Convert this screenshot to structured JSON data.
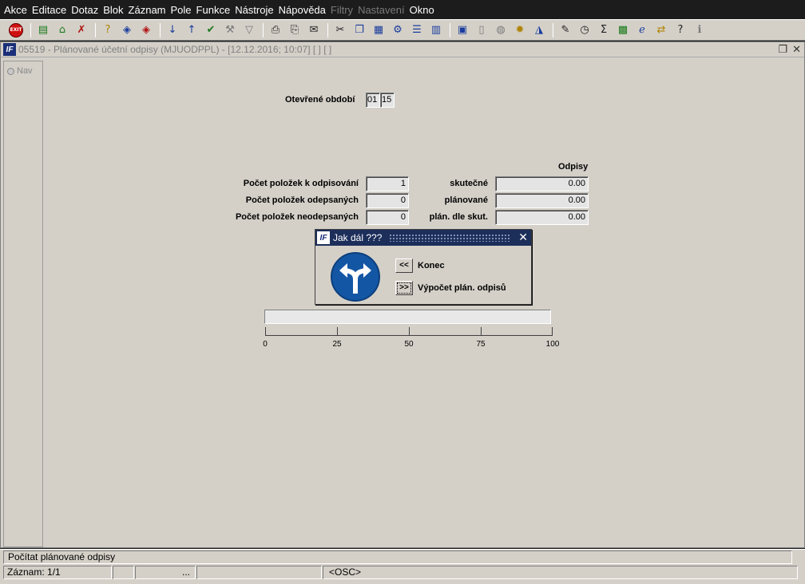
{
  "menu": [
    "Akce",
    "Editace",
    "Dotaz",
    "Blok",
    "Záznam",
    "Pole",
    "Funkce",
    "Nástroje",
    "Nápověda",
    "Filtry",
    "Nastavení",
    "Okno"
  ],
  "menu_disabled": [
    "Filtry",
    "Nastavení"
  ],
  "toolbar": {
    "exit_label": "EXIT",
    "icons": [
      "exit-icon",
      "insert-record-icon",
      "insert-record-alt-icon",
      "delete-record-icon",
      "query-icon",
      "query-run-icon",
      "query-cancel-icon",
      "sort-asc-icon",
      "sort-desc-icon",
      "check-icon",
      "wrench-icon",
      "filter-icon",
      "print-icon",
      "print-setup-icon",
      "mail-icon",
      "cut-icon",
      "copy-icon",
      "paste-icon",
      "tools-icon",
      "list-icon",
      "tree-icon",
      "report-icon",
      "document-icon",
      "globe-icon",
      "settings-icon",
      "eye-icon",
      "edit-icon",
      "calculator-icon",
      "sigma-icon",
      "excel-icon",
      "explorer-icon",
      "switch-icon",
      "help-icon",
      "info-icon"
    ]
  },
  "window": {
    "logo": "IF",
    "title": "05519 - Plánované účetní odpisy (MJUODPPL) - [12.12.2016; 10:07]  [ ]  [ ]",
    "nav_label": "Nav"
  },
  "form": {
    "period_label": "Otevřené období",
    "period_month": "01",
    "period_year": "15",
    "odpisy_header": "Odpisy",
    "rows": [
      {
        "label": "Počet položek k odpisování",
        "count": "1",
        "odpis_label": "skutečné",
        "odpis_value": "0.00"
      },
      {
        "label": "Počet položek odepsaných",
        "count": "0",
        "odpis_label": "plánované",
        "odpis_value": "0.00"
      },
      {
        "label": "Počet položek neodepsaných",
        "count": "0",
        "odpis_label": "plán. dle skut.",
        "odpis_value": "0.00"
      }
    ]
  },
  "dialog": {
    "logo": "IF",
    "title": "Jak dál ???",
    "back_button": "<<",
    "back_label": "Konec",
    "next_button": ">>",
    "next_label": "Výpočet plán. odpisů"
  },
  "progress": {
    "value": 0,
    "ticks": [
      "0",
      "25",
      "50",
      "75",
      "100"
    ]
  },
  "status": {
    "hint": "Počítat plánované odpisy",
    "record": "Záznam: 1/1",
    "ellipsis": "...",
    "mode": "<OSC>"
  }
}
